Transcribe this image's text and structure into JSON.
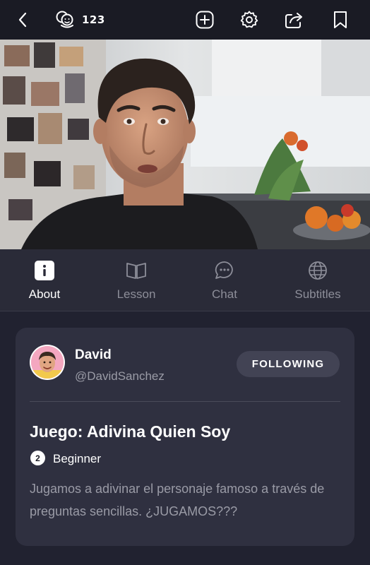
{
  "header": {
    "viewer_count": "123",
    "icons": [
      "back-icon",
      "viewers-icon",
      "add-icon",
      "gear-icon",
      "share-icon",
      "bookmark-icon"
    ]
  },
  "tabs": [
    {
      "label": "About",
      "icon": "info-icon",
      "active": true
    },
    {
      "label": "Lesson",
      "icon": "book-icon",
      "active": false
    },
    {
      "label": "Chat",
      "icon": "chat-icon",
      "active": false
    },
    {
      "label": "Subtitles",
      "icon": "globe-icon",
      "active": false
    }
  ],
  "author": {
    "name": "David",
    "handle": "@DavidSanchez",
    "follow_label": "FOLLOWING"
  },
  "lesson": {
    "title": "Juego: Adivina Quien Soy",
    "level_number": "2",
    "level_label": "Beginner",
    "description": "Jugamos a adivinar el personaje famoso a través de preguntas sencillas. ¿JUGAMOS???"
  },
  "colors": {
    "background": "#212230",
    "topbar": "#1a1b24",
    "tabbar": "#2a2b38",
    "card": "#2f3040",
    "button": "#424354",
    "muted_text": "#9a9ba6"
  }
}
